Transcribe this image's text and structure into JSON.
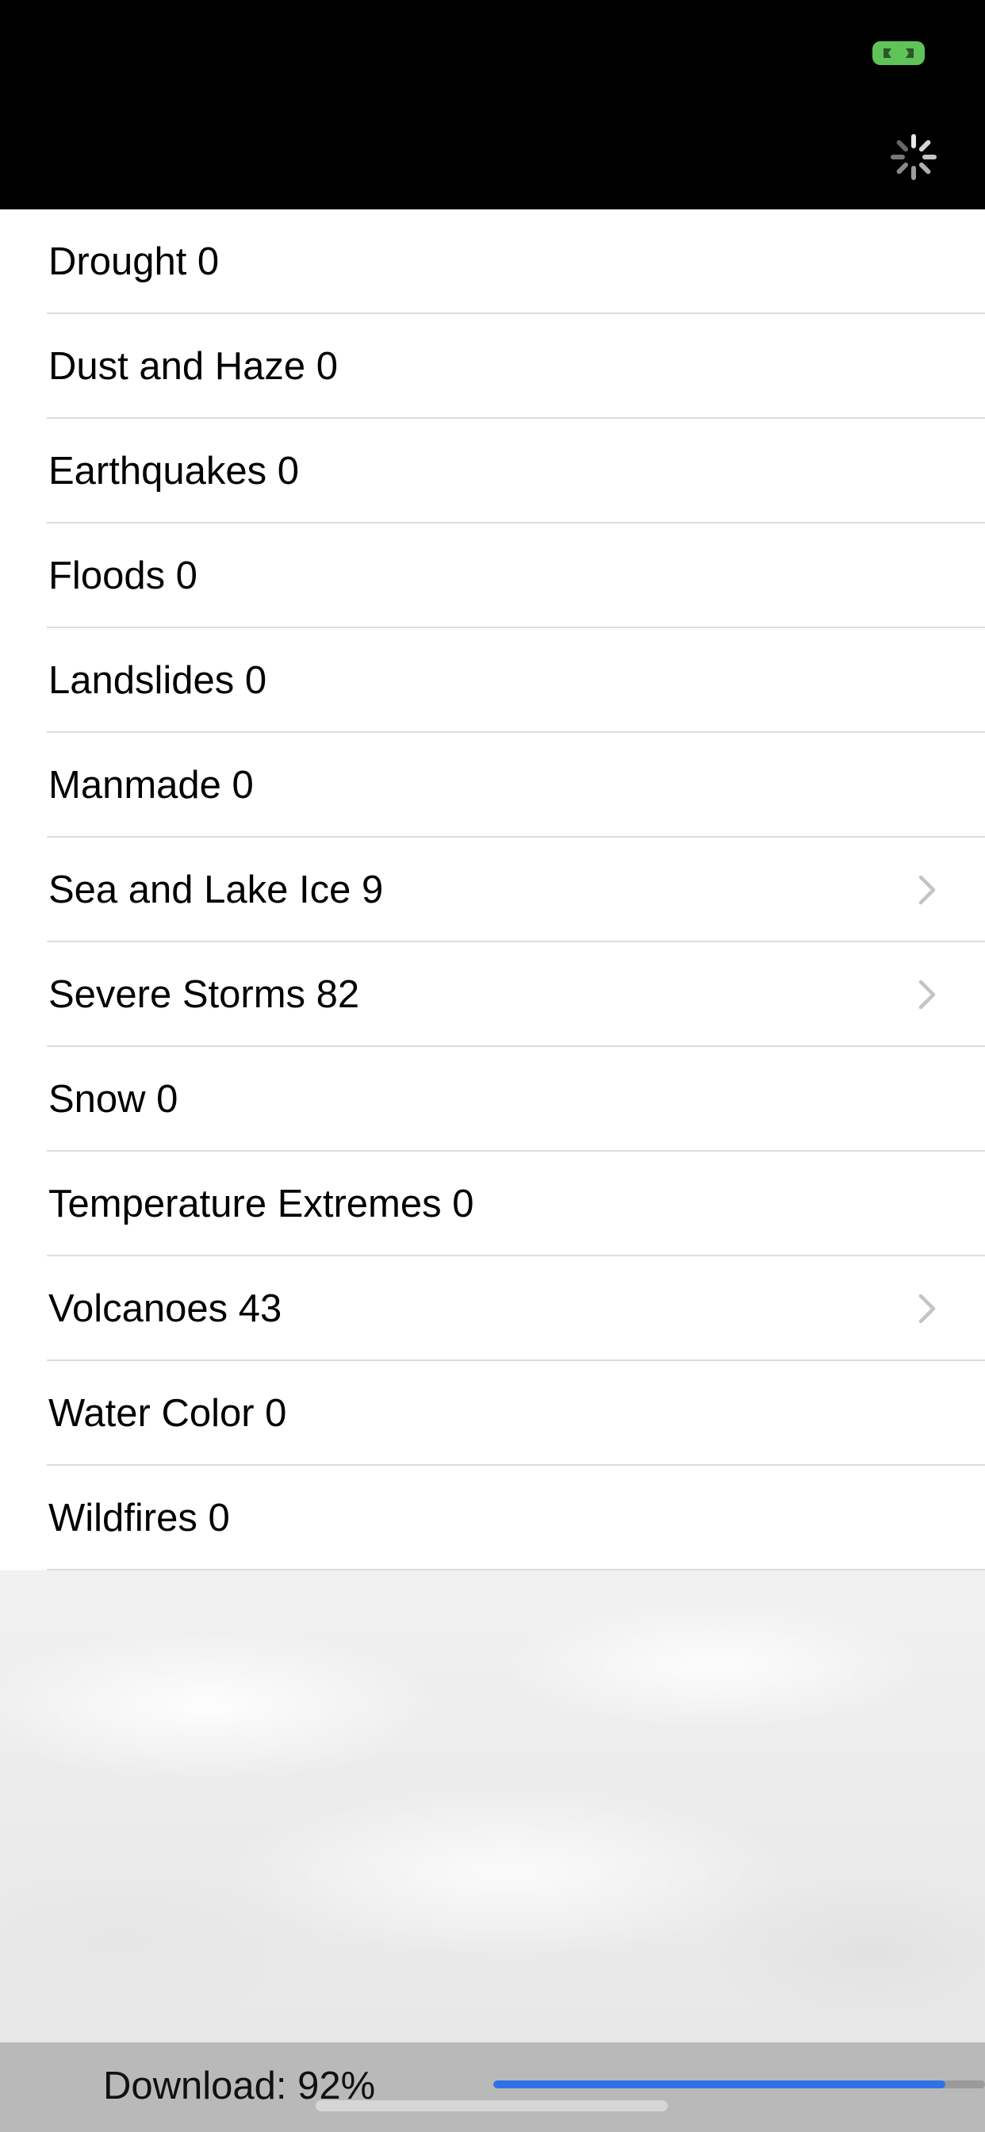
{
  "status_bar": {
    "recording_indicator_icon": "screen-recording-icon",
    "recording_indicator_color": "#5fc35a",
    "spinner_icon": "activity-spinner-icon"
  },
  "categories": [
    {
      "label": "Drought 0",
      "has_disclosure": false
    },
    {
      "label": "Dust and Haze 0",
      "has_disclosure": false
    },
    {
      "label": "Earthquakes 0",
      "has_disclosure": false
    },
    {
      "label": "Floods 0",
      "has_disclosure": false
    },
    {
      "label": "Landslides 0",
      "has_disclosure": false
    },
    {
      "label": "Manmade 0",
      "has_disclosure": false
    },
    {
      "label": "Sea and Lake Ice 9",
      "has_disclosure": true
    },
    {
      "label": "Severe Storms 82",
      "has_disclosure": true
    },
    {
      "label": "Snow 0",
      "has_disclosure": false
    },
    {
      "label": "Temperature Extremes 0",
      "has_disclosure": false
    },
    {
      "label": "Volcanoes 43",
      "has_disclosure": true
    },
    {
      "label": "Water Color 0",
      "has_disclosure": false
    },
    {
      "label": "Wildfires 0",
      "has_disclosure": false
    }
  ],
  "download": {
    "label": "Download: 92%",
    "progress": 0.92,
    "progress_color": "#2f72e6"
  },
  "colors": {
    "accent": "#2f72e6",
    "status_bar_bg": "#000000",
    "separator": "#dcdcdf"
  }
}
